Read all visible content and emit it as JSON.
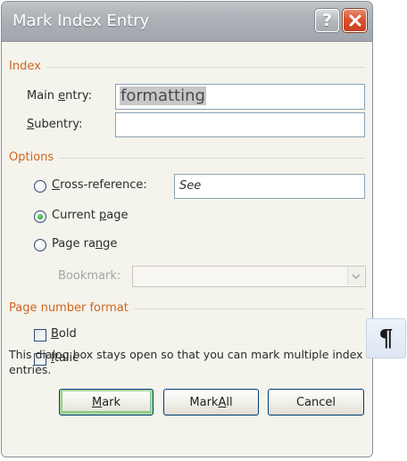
{
  "window": {
    "title": "Mark Index Entry",
    "help_label": "?",
    "close_label": "✕"
  },
  "index": {
    "heading": "Index",
    "main_entry_label_pre": "Main ",
    "main_entry_label_u": "e",
    "main_entry_label_post": "ntry:",
    "main_entry_value": "formatting",
    "subentry_label_u": "S",
    "subentry_label_post": "ubentry:",
    "subentry_value": ""
  },
  "options": {
    "heading": "Options",
    "cross_reference_label_u": "C",
    "cross_reference_label_post": "ross-reference:",
    "cross_reference_value": "See",
    "current_page_label_pre": "Current ",
    "current_page_label_u": "p",
    "current_page_label_post": "age",
    "page_range_label_pre": "Page ra",
    "page_range_label_u": "n",
    "page_range_label_post": "ge",
    "bookmark_label": "Bookmark:",
    "bookmark_value": "",
    "selected": "current_page"
  },
  "page_number_format": {
    "heading": "Page number format",
    "bold_label_u": "B",
    "bold_label_post": "old",
    "bold_checked": false,
    "italic_label_u": "I",
    "italic_label_post": "talic",
    "italic_checked": false
  },
  "note": "This dialog box stays open so that you can mark multiple index entries.",
  "buttons": {
    "mark_u": "M",
    "mark_post": "ark",
    "mark_all_pre": "Mark ",
    "mark_all_u": "A",
    "mark_all_post": "ll",
    "cancel": "Cancel"
  },
  "pilcrow": {
    "symbol": "¶",
    "icon": "pilcrow-icon"
  },
  "colors": {
    "section_heading": "#d0651d",
    "titlebar": "#a9aeb4",
    "close_button": "#d8532f",
    "dialog_background": "#f4f3ec"
  }
}
